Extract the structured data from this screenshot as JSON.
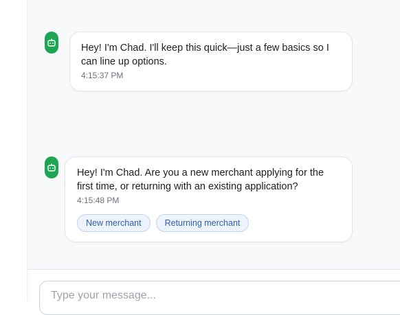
{
  "messages": [
    {
      "sender": "bot",
      "avatar_icon": "robot-icon",
      "text": "Hey! I'm Chad. I'll keep this quick—just a few basics so I can line up options.",
      "time": "4:15:37 PM"
    },
    {
      "sender": "bot",
      "avatar_icon": "robot-icon",
      "text": "Hey! I'm Chad. Are you a new merchant applying for the first time, or returning with an existing application?",
      "time": "4:15:48 PM",
      "quick_replies": [
        "New merchant",
        "Returning merchant"
      ]
    }
  ],
  "composer": {
    "placeholder": "Type your message..."
  },
  "colors": {
    "avatar_bg": "#1da553",
    "chip_bg": "#eef4fd",
    "chip_border": "#bcd3f5",
    "chip_text": "#2d5fb0"
  }
}
